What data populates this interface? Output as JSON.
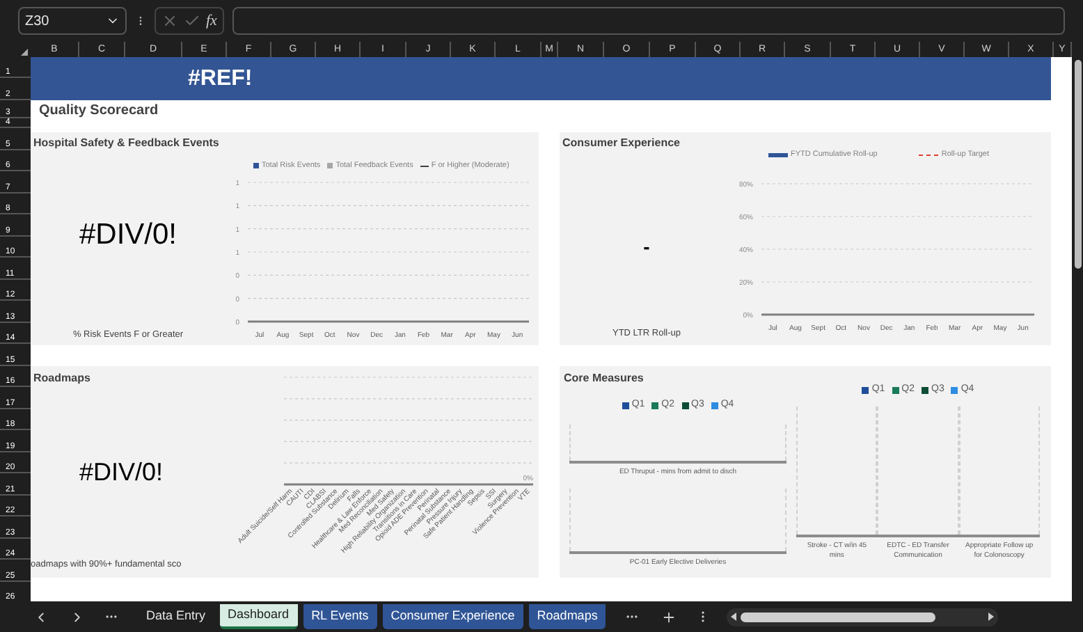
{
  "formula_bar": {
    "name_box": "Z30",
    "fx": "fx"
  },
  "columns": [
    "B",
    "C",
    "D",
    "E",
    "F",
    "G",
    "H",
    "I",
    "J",
    "K",
    "L",
    "M",
    "N",
    "O",
    "P",
    "Q",
    "R",
    "S",
    "T",
    "U",
    "V",
    "W",
    "X",
    "Y"
  ],
  "rows": [
    "1",
    "2",
    "3",
    "4",
    "5",
    "6",
    "7",
    "8",
    "9",
    "10",
    "11",
    "12",
    "13",
    "14",
    "15",
    "16",
    "17",
    "18",
    "19",
    "20",
    "21",
    "22",
    "23",
    "24",
    "25",
    "26"
  ],
  "banner": "#REF!",
  "title": "Quality Scorecard",
  "hospital": {
    "title": "Hospital Safety & Feedback Events",
    "value": "#DIV/0!",
    "caption": "% Risk Events F or Greater",
    "legend": [
      {
        "label": "Total Risk Events",
        "kind": "bar",
        "color": "#2f5597"
      },
      {
        "label": "Total Feedback Events",
        "kind": "bar",
        "color": "#a6a6a6"
      },
      {
        "label": "F or Higher (Moderate)",
        "kind": "line",
        "color": "#404040"
      }
    ],
    "chart_data": {
      "type": "bar",
      "categories": [
        "Jul",
        "Aug",
        "Sept",
        "Oct",
        "Nov",
        "Dec",
        "Jan",
        "Feb",
        "Mar",
        "Apr",
        "May",
        "Jun"
      ],
      "ylim": [
        0,
        1.2
      ],
      "grid": true,
      "yticks": [
        {
          "value": 0,
          "label": "0"
        },
        {
          "value": 0.2,
          "label": "0"
        },
        {
          "value": 0.4,
          "label": "0"
        },
        {
          "value": 0.6,
          "label": "1"
        },
        {
          "value": 0.8,
          "label": "1"
        },
        {
          "value": 1,
          "label": "1"
        },
        {
          "value": 1.2,
          "label": "1"
        }
      ]
    }
  },
  "consumer": {
    "title": "Consumer Experience",
    "value": "-",
    "caption": "YTD LTR Roll-up",
    "legend": [
      {
        "label": "FYTD Cumulative Roll-up",
        "kind": "bar",
        "color": "#2f5597"
      },
      {
        "label": "Roll-up Target",
        "kind": "dash",
        "color": "#e03c31"
      }
    ],
    "chart_data": {
      "type": "bar",
      "categories": [
        "Jul",
        "Aug",
        "Sept",
        "Oct",
        "Nov",
        "Dec",
        "Jan",
        "Feb",
        "Mar",
        "Apr",
        "May",
        "Jun"
      ],
      "ylim": [
        0,
        0.8
      ],
      "grid": true,
      "yticks": [
        {
          "value": 0,
          "label": "0%"
        },
        {
          "value": 0.2,
          "label": "20%"
        },
        {
          "value": 0.4,
          "label": "40%"
        },
        {
          "value": 0.6,
          "label": "60%"
        },
        {
          "value": 0.8,
          "label": "80%"
        }
      ]
    }
  },
  "roadmaps": {
    "title": "Roadmaps",
    "value": "#DIV/0!",
    "caption": "oadmaps with 90%+ fundamental sco",
    "tick_label": "0%",
    "categories": [
      "Adult Suicide/Self Harm",
      "CAUTI",
      "CDI",
      "CLABSI",
      "Controlled Substance",
      "Delirium",
      "Falls",
      "Healthcare & Law Enforce",
      "Med Reconciliation",
      "Med Safety",
      "High Reliability Organization",
      "Transitions in Care",
      "Opioid ADE Prevention",
      "Perinatal",
      "Perinatal Substance",
      "Pressure Injury",
      "Safe Patient Handling",
      "Sepsis",
      "SSI",
      "Surgery",
      "Violence Prevention",
      "VTE"
    ]
  },
  "core": {
    "title": "Core Measures",
    "legend": [
      {
        "label": "Q1",
        "color": "#1f4e9a"
      },
      {
        "label": "Q2",
        "color": "#1a7a5a"
      },
      {
        "label": "Q3",
        "color": "#0e4d35"
      },
      {
        "label": "Q4",
        "color": "#2e8de0"
      }
    ],
    "legend_right": [
      {
        "label": "Q1",
        "color": "#1f4e9a"
      },
      {
        "label": "Q2",
        "color": "#1a7a5a"
      },
      {
        "label": "Q3",
        "color": "#0e4d35"
      },
      {
        "label": "Q4",
        "color": "#2e8de0"
      }
    ],
    "chart_a": [
      "ED Thruput - mins from admit to disch"
    ],
    "chart_b": [
      "PC-01 Early Elective Deliveries"
    ],
    "chart_c": [
      "Stroke - CT w/in 45 mins",
      "EDTC - ED Transfer Communication",
      "Appropriate Follow up for Colonoscopy"
    ]
  },
  "sheet_tabs": [
    {
      "label": "Data Entry",
      "selected": false
    },
    {
      "label": "Dashboard",
      "selected": true,
      "color": "#1e7145"
    },
    {
      "label": "RL Events",
      "selected": false,
      "color": "#2f5597"
    },
    {
      "label": "Consumer Experience",
      "selected": false,
      "color": "#2f5597"
    },
    {
      "label": "Roadmaps",
      "selected": false,
      "color": "#2f5597"
    }
  ]
}
